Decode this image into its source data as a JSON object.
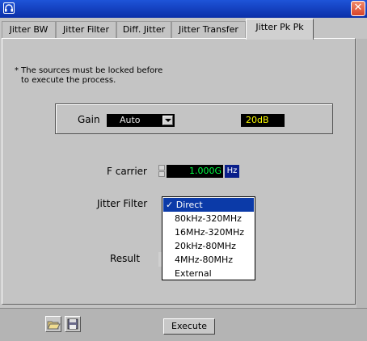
{
  "window": {
    "close_label": "✕"
  },
  "tabs": [
    {
      "label": "Jitter BW"
    },
    {
      "label": "Jitter Filter"
    },
    {
      "label": "Diff. Jitter"
    },
    {
      "label": "Jitter Transfer"
    },
    {
      "label": "Jitter Pk Pk",
      "active": true
    }
  ],
  "note": {
    "line1": "* The sources must be locked before",
    "line2": "to execute the process."
  },
  "gain": {
    "label": "Gain",
    "value": "Auto",
    "db_value": "20dB"
  },
  "fcarrier": {
    "label": "F carrier",
    "value": "1.000G",
    "unit": "Hz"
  },
  "jitter_filter": {
    "label": "Jitter Filter",
    "options": [
      "Direct",
      "80kHz-320MHz",
      "16MHz-320MHz",
      "20kHz-80MHz",
      "4MHz-80MHz",
      "External"
    ],
    "selected_mark": "✓"
  },
  "result": {
    "label": "Result"
  },
  "toolbar": {
    "execute_label": "Execute"
  }
}
